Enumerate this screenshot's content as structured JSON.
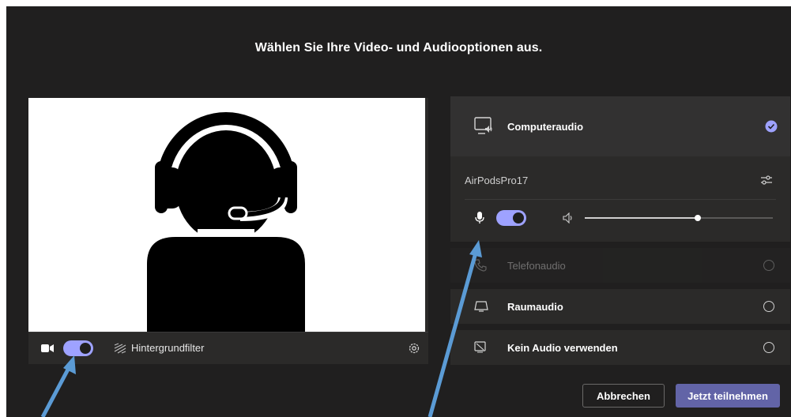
{
  "dialog": {
    "title": "Wählen Sie Ihre Video- und Audiooptionen aus."
  },
  "video": {
    "camera_on": true,
    "background_filter_label": "Hintergrundfilter",
    "preview_image": "headset-user-silhouette"
  },
  "audio": {
    "computer_audio": {
      "label": "Computeraudio",
      "selected": true,
      "icon": "computer-audio-icon"
    },
    "device": {
      "name": "AirPodsPro17",
      "mic_on": true,
      "speaker_volume": 0.6
    },
    "phone_audio": {
      "label": "Telefonaudio",
      "disabled": true,
      "icon": "phone-icon"
    },
    "room_audio": {
      "label": "Raumaudio",
      "selected": false,
      "icon": "room-audio-icon"
    },
    "no_audio": {
      "label": "Kein Audio verwenden",
      "selected": false,
      "icon": "no-audio-icon"
    }
  },
  "buttons": {
    "cancel": "Abbrechen",
    "join": "Jetzt teilnehmen"
  },
  "colors": {
    "accent": "#6264a7",
    "toggle": "#9ea2ff",
    "background": "#201f1f",
    "panel": "#2b2a29",
    "arrow": "#5b9bd5"
  }
}
